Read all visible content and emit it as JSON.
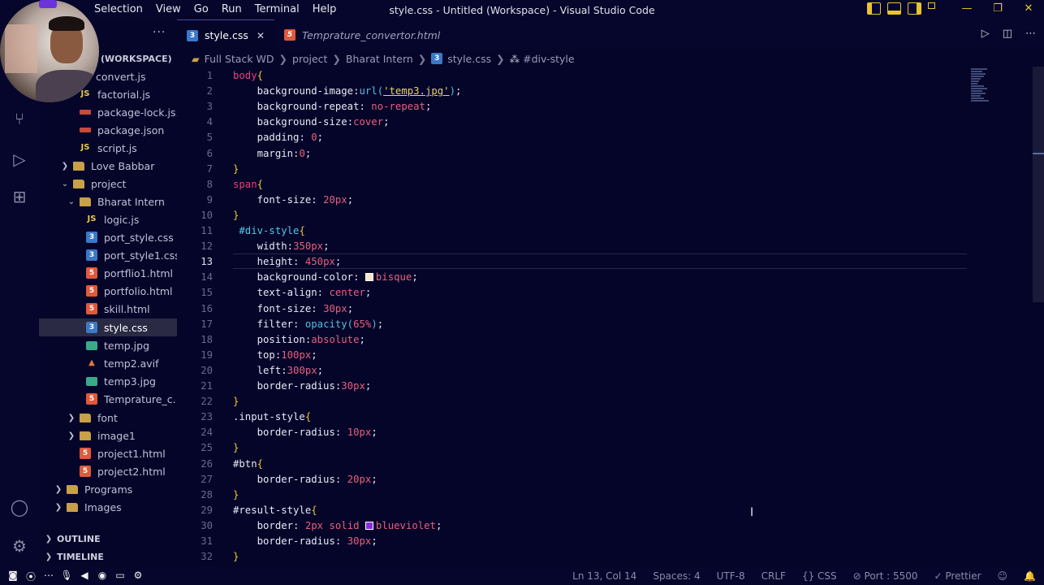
{
  "window": {
    "title": "style.css - Untitled (Workspace) - Visual Studio Code",
    "menu": [
      "Selection",
      "View",
      "Go",
      "Run",
      "Terminal",
      "Help"
    ]
  },
  "sidebar": {
    "more_label": "···",
    "workspace_label": "(WORKSPACE)",
    "items": [
      {
        "label": "convert.js",
        "icon": "js"
      },
      {
        "label": "factorial.js",
        "icon": "js"
      },
      {
        "label": "package-lock.js...",
        "icon": "json"
      },
      {
        "label": "package.json",
        "icon": "json"
      },
      {
        "label": "script.js",
        "icon": "js"
      },
      {
        "label": "Love Babbar",
        "icon": "folder"
      },
      {
        "label": "project",
        "icon": "folder"
      },
      {
        "label": "Bharat Intern",
        "icon": "folder"
      },
      {
        "label": "logic.js",
        "icon": "js"
      },
      {
        "label": "port_style.css",
        "icon": "css"
      },
      {
        "label": "port_style1.css",
        "icon": "css"
      },
      {
        "label": "portflio1.html",
        "icon": "html"
      },
      {
        "label": "portfolio.html",
        "icon": "html"
      },
      {
        "label": "skill.html",
        "icon": "html"
      },
      {
        "label": "style.css",
        "icon": "css"
      },
      {
        "label": "temp.jpg",
        "icon": "img"
      },
      {
        "label": "temp2.avif",
        "icon": "avif"
      },
      {
        "label": "temp3.jpg",
        "icon": "img"
      },
      {
        "label": "Temprature_c...",
        "icon": "html"
      },
      {
        "label": "font",
        "icon": "folder"
      },
      {
        "label": "image1",
        "icon": "folder"
      },
      {
        "label": "project1.html",
        "icon": "html"
      },
      {
        "label": "project2.html",
        "icon": "html"
      },
      {
        "label": "Programs",
        "icon": "folder"
      },
      {
        "label": "Images",
        "icon": "folder"
      }
    ],
    "outline_label": "OUTLINE",
    "timeline_label": "TIMELINE"
  },
  "tabs": [
    {
      "label": "style.css",
      "close": "✕"
    },
    {
      "label": "Temprature_convertor.html"
    }
  ],
  "breadcrumb": [
    "Full Stack WD",
    "project",
    "Bharat Intern",
    "style.css",
    "#div-style"
  ],
  "editor": {
    "current_line": 13
  },
  "statusbar": {
    "position": "Ln 13, Col 14",
    "spaces": "Spaces: 4",
    "encoding": "UTF-8",
    "eol": "CRLF",
    "language": "{} CSS",
    "port": "⊘ Port : 5500",
    "prettier": "✓ Prettier"
  },
  "colors": {
    "background": "#05052a",
    "accent": "#e8c430",
    "selector": "#e8407a",
    "bisque": "#ffe4c4",
    "blueviolet": "#8a2be2"
  }
}
